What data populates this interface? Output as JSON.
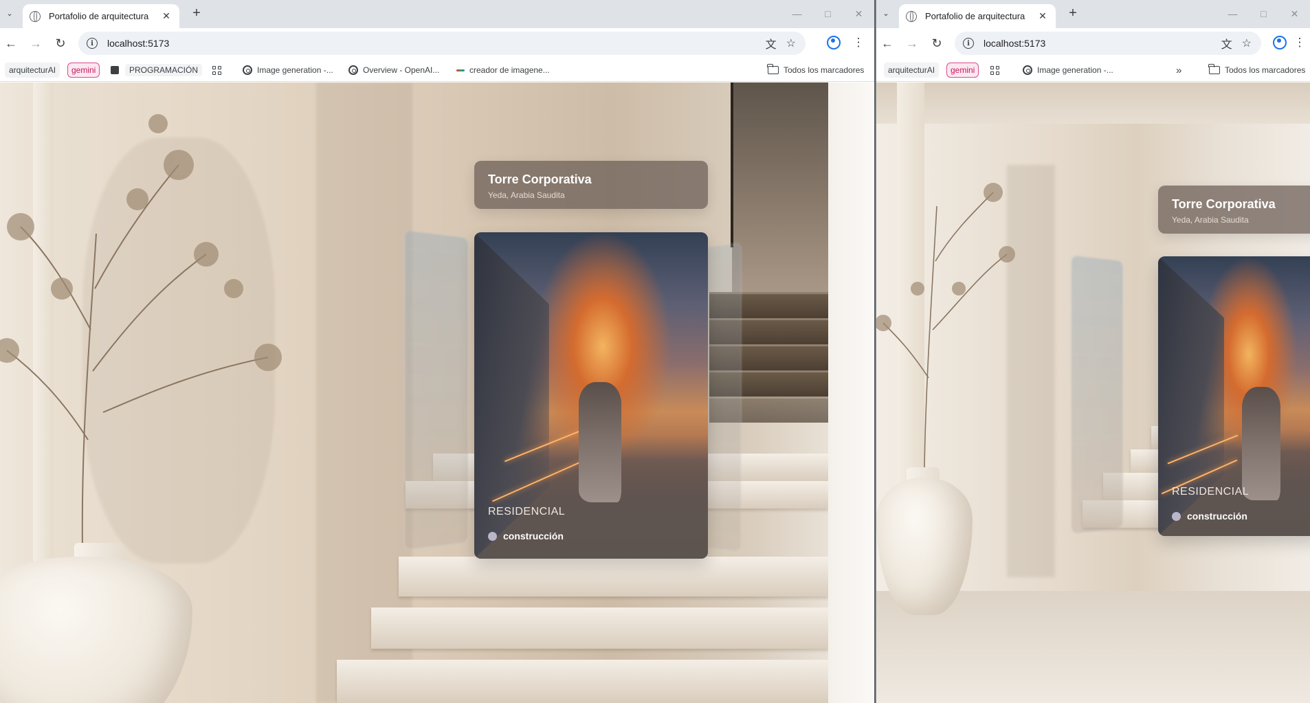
{
  "left_window": {
    "tab": {
      "title": "Portafolio de arquitectura"
    },
    "address_bar": {
      "url": "localhost:5173"
    },
    "bookmarks": {
      "items": [
        {
          "label": "arquitecturAI"
        },
        {
          "label": "gemini"
        },
        {
          "label": "PROGRAMACIÓN"
        },
        {
          "label": "Image generation -..."
        },
        {
          "label": "Overview - OpenAI..."
        },
        {
          "label": "creador de imagene..."
        }
      ],
      "all_bookmarks": "Todos los marcadores"
    },
    "info_card": {
      "title": "Torre Corporativa",
      "location": "Yeda, Arabia Saudita"
    },
    "project_card": {
      "category": "RESIDENCIAL",
      "status": "construcción",
      "status_color": "#b9b6c9"
    }
  },
  "right_window": {
    "tab": {
      "title": "Portafolio de arquitectura"
    },
    "address_bar": {
      "url": "localhost:5173"
    },
    "bookmarks": {
      "items": [
        {
          "label": "arquitecturAI"
        },
        {
          "label": "gemini"
        },
        {
          "label": "Image generation -..."
        }
      ],
      "all_bookmarks": "Todos los marcadores"
    },
    "info_card": {
      "title": "Torre Corporativa",
      "location": "Yeda, Arabia Saudita"
    },
    "project_card": {
      "category": "RESIDENCIAL",
      "status": "construcción",
      "status_color": "#b9b6c9"
    }
  },
  "icons": {
    "tab_search": "chevron-down-icon",
    "close": "close-icon",
    "new_tab": "plus-icon",
    "back": "arrow-left-icon",
    "forward": "arrow-right-icon",
    "reload": "reload-icon",
    "translate": "translate-icon",
    "star": "star-icon",
    "profile": "profile-icon",
    "menu": "kebab-menu-icon",
    "apps": "apps-grid-icon",
    "folder": "folder-icon",
    "overflow": "double-chevron-icon"
  },
  "colors": {
    "accent": "#1a73e8",
    "gemini_chip": "#d64c8f"
  }
}
